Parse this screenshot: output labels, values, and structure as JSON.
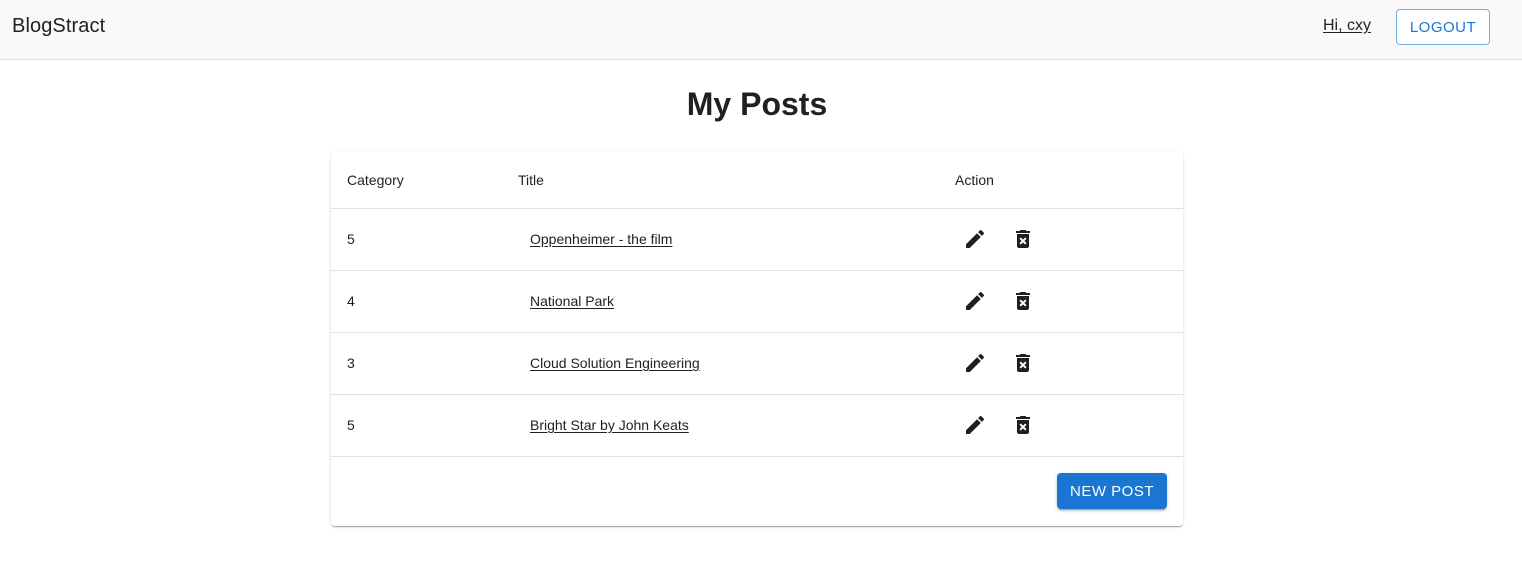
{
  "header": {
    "brand": "BlogStract",
    "greeting": "Hi, cxy",
    "logout_label": "LOGOUT"
  },
  "main": {
    "title": "My Posts",
    "columns": [
      "Category",
      "Title",
      "Action"
    ],
    "rows": [
      {
        "category": "5",
        "title": "Oppenheimer - the film"
      },
      {
        "category": "4",
        "title": "National Park"
      },
      {
        "category": "3",
        "title": "Cloud Solution Engineering"
      },
      {
        "category": "5",
        "title": "Bright Star by John Keats"
      }
    ],
    "row_action_icons": [
      "edit-icon",
      "delete-forever-icon"
    ],
    "new_post_label": "NEW POST"
  },
  "colors": {
    "primary": "#1976d2",
    "appbar_bg": "#f9f9f9",
    "text": "#212121"
  }
}
